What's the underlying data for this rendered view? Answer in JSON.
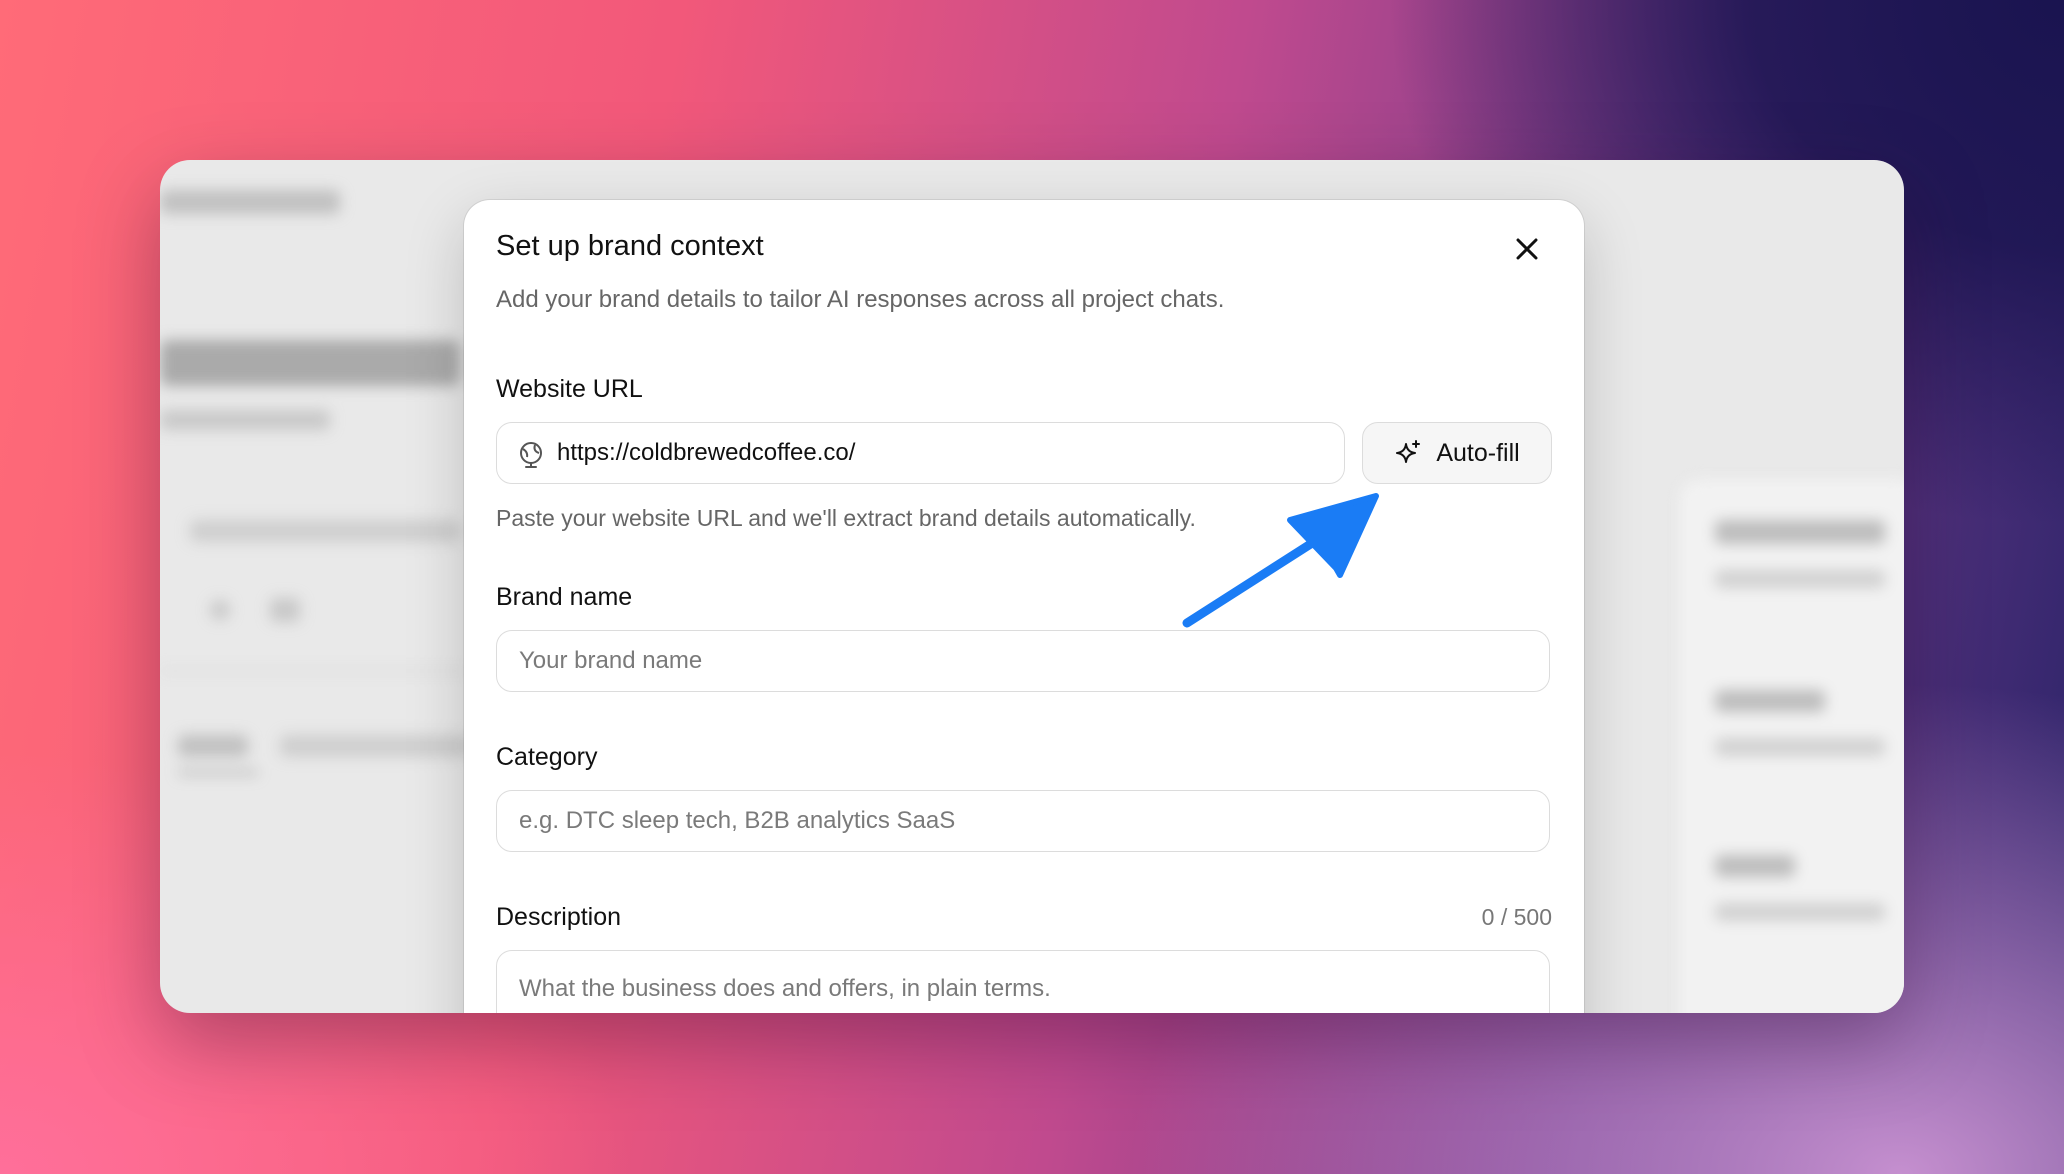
{
  "modal": {
    "title": "Set up brand context",
    "subtitle": "Add your brand details to tailor AI responses across all project chats.",
    "close_icon": "close-icon"
  },
  "website": {
    "label": "Website URL",
    "value": "https://coldbrewedcoffee.co/",
    "icon": "globe-icon",
    "autofill_label": "Auto-fill",
    "autofill_icon": "sparkle-icon",
    "hint": "Paste your website URL and we'll extract brand details automatically."
  },
  "brand_name": {
    "label": "Brand name",
    "placeholder": "Your brand name"
  },
  "category": {
    "label": "Category",
    "placeholder": "e.g. DTC sleep tech, B2B analytics SaaS"
  },
  "description": {
    "label": "Description",
    "counter": "0 / 500",
    "placeholder": "What the business does and offers, in plain terms."
  },
  "colors": {
    "arrow": "#1a7cf5",
    "background_dark": "#1a1450",
    "background_pink": "#ff6b78"
  }
}
